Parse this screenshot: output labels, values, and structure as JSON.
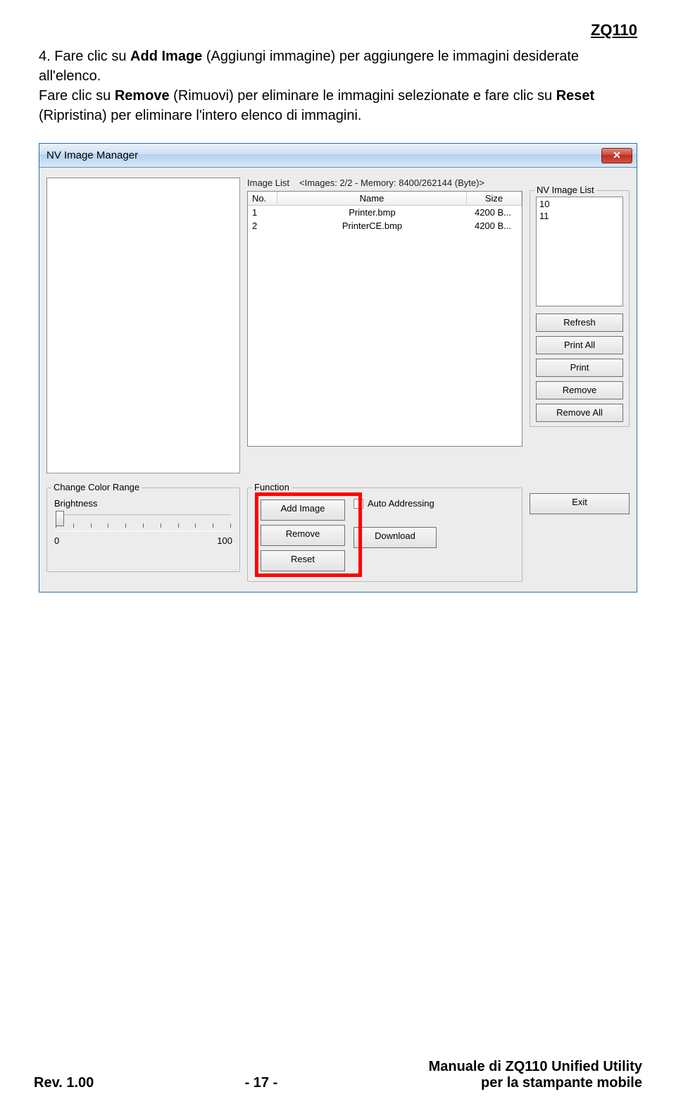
{
  "header_code": "ZQ110",
  "instructions_html_prefix": "4. Fare clic su ",
  "instr_addimage": "Add Image",
  "instr_mid1": " (Aggiungi immagine) per aggiungere le immagini desiderate all'elenco.",
  "instr_line2_pre": "Fare clic su ",
  "instr_remove": "Remove",
  "instr_line2_mid": " (Rimuovi) per eliminare le immagini selezionate e fare clic su ",
  "instr_reset": "Reset",
  "instr_line2_end": " (Ripristina) per eliminare l'intero elenco di immagini.",
  "window": {
    "title": "NV Image Manager",
    "close_x": "✕",
    "image_list_label": "Image List",
    "image_list_info": "<Images: 2/2 - Memory: 8400/262144 (Byte)>",
    "columns": {
      "no": "No.",
      "name": "Name",
      "size": "Size"
    },
    "rows": [
      {
        "no": "1",
        "name": "Printer.bmp",
        "size": "4200 B..."
      },
      {
        "no": "2",
        "name": "PrinterCE.bmp",
        "size": "4200 B..."
      }
    ],
    "nv_list_legend": "NV Image List",
    "nv_items": [
      "10",
      "11"
    ],
    "buttons": {
      "refresh": "Refresh",
      "print_all": "Print All",
      "print": "Print",
      "remove": "Remove",
      "remove_all": "Remove All",
      "exit": "Exit"
    },
    "color_range": {
      "legend": "Change Color Range",
      "brightness": "Brightness",
      "min": "0",
      "max": "100"
    },
    "function": {
      "legend": "Function",
      "add_image": "Add Image",
      "remove": "Remove",
      "reset": "Reset",
      "auto_addressing": "Auto Addressing",
      "download": "Download"
    }
  },
  "footer": {
    "rev": "Rev. 1.00",
    "page": "- 17 -",
    "manual_l1": "Manuale di ZQ110 Unified Utility",
    "manual_l2": "per la stampante mobile"
  }
}
